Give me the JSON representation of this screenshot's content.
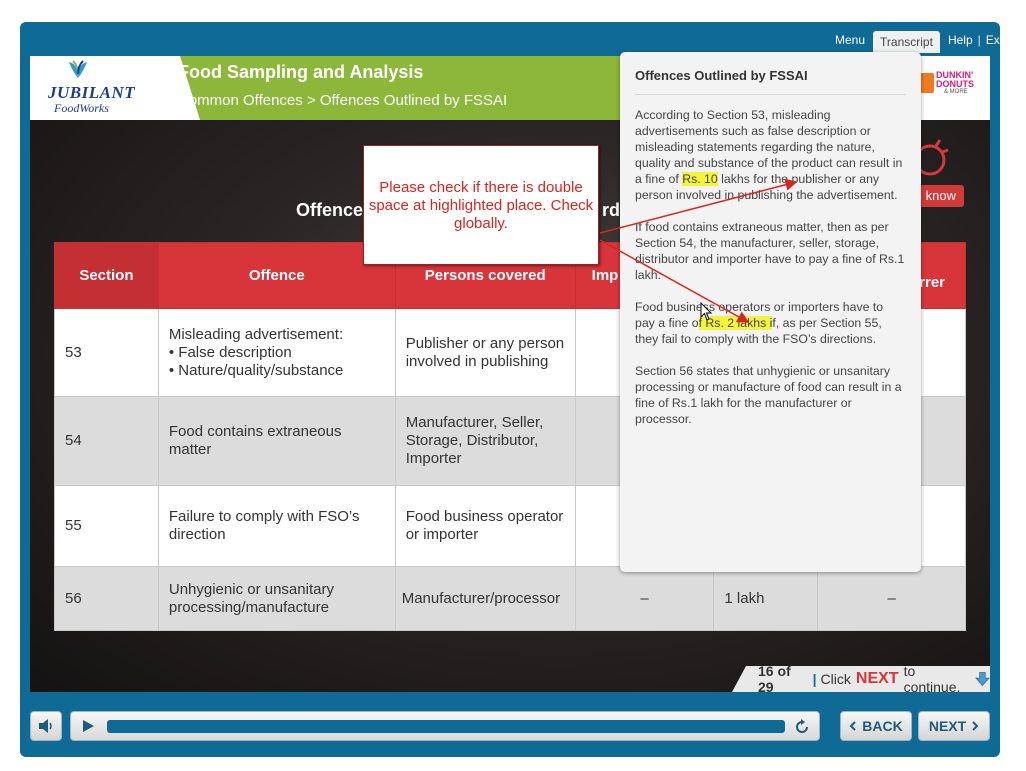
{
  "menu": {
    "menu": "Menu",
    "transcript": "Transcript",
    "help": "Help",
    "exit": "Exit",
    "sep": "|"
  },
  "logo": {
    "line1": "JUBILANT",
    "line2": "FoodWorks"
  },
  "dunkin": {
    "line1": "DUNKIN'",
    "line2": "DONUTS",
    "line3": "& MORE"
  },
  "header": {
    "title": "Food Sampling and Analysis",
    "subtitle": "Common Offences > Offences Outlined by FSSAI"
  },
  "stage": {
    "title_left": "Offence",
    "title_right": "rdi",
    "know_label": "know"
  },
  "table": {
    "headers": [
      "Section",
      "Offence",
      "Persons covered",
      "Imp",
      "",
      "rrer"
    ],
    "rows": [
      {
        "section": "53",
        "offence_lines": [
          "Misleading advertisement:",
          "• False description",
          "• Nature/quality/substance"
        ],
        "persons": "Publisher or any person involved in publishing",
        "imp": "",
        "fine": "",
        "other": ""
      },
      {
        "section": "54",
        "offence_lines": [
          "Food contains extraneous matter"
        ],
        "persons": "Manufacturer, Seller, Storage, Distributor, Importer",
        "imp": "",
        "fine": "",
        "other": ""
      },
      {
        "section": "55",
        "offence_lines": [
          "Failure to comply with FSO’s direction"
        ],
        "persons": "Food business operator or importer",
        "imp": "",
        "fine": "",
        "other": ""
      },
      {
        "section": "56",
        "offence_lines": [
          "Unhygienic or unsanitary processing/manufacture"
        ],
        "persons": "Manufacturer/processor",
        "imp": "–",
        "fine": "1 lakh",
        "other": "–"
      }
    ]
  },
  "pagebar": {
    "count": "16 of 29",
    "sep": "|",
    "pre": "Click",
    "next_word": "NEXT",
    "post": "to continue."
  },
  "controls": {
    "back": "BACK",
    "next": "NEXT"
  },
  "transcript": {
    "heading": "Offences Outlined by FSSAI",
    "p1_a": "According to Section 53, misleading advertisements such as false description or misleading statements regarding the nature, quality and substance of the product can result in a fine of",
    "p1_hl": "Rs. 10",
    "p1_b": "lakhs for the publisher or any person involved in publishing the advertisement.",
    "p2": "If food contains extraneous matter, then as per Section 54, the manufacturer, seller, storage, distributor and importer have to pay a fine of Rs.1 lakh.",
    "p3_a": "Food business operators or importers have to pay a fine o",
    "p3_hl": "f Rs. 2 lakhs i",
    "p3_b": "f, as per Section 55, they fail to comply with the FSO’s directions.",
    "p4": "Section 56 states that unhygienic or unsanitary processing or manufacture of food can result in a fine of Rs.1 lakh for the manufacturer or processor."
  },
  "note": {
    "text": "Please check if there is double space at highlighted place. Check globally."
  },
  "colors": {
    "frame": "#0f6b96",
    "header_green": "#8cb73a",
    "table_red": "#d7353a",
    "highlight": "#f4f43a",
    "note_red": "#d8261f"
  },
  "icons": [
    "leaf-logo-icon",
    "bulb-icon",
    "download-arrow-icon",
    "volume-icon",
    "play-icon",
    "replay-icon",
    "chevron-left-icon",
    "chevron-right-icon",
    "cursor-icon"
  ]
}
